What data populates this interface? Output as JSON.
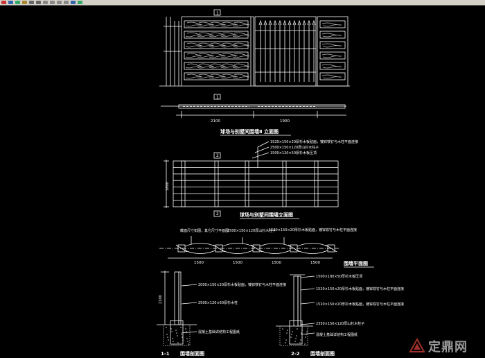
{
  "colors": {
    "background": "#000000",
    "lines": "#ffffff",
    "toolbar": "#d4d0c8",
    "watermark": "#9a9a9a"
  },
  "toolbar": {
    "icons": [
      "cut-icon",
      "copy-icon",
      "paste-icon",
      "match-properties-icon",
      "undo-icon",
      "redo-icon",
      "pan-icon",
      "zoom-realtime-icon",
      "zoom-window-icon",
      "zoom-previous-icon",
      "properties-icon",
      "design-center-icon"
    ]
  },
  "elevation1": {
    "section_marker_top": "1",
    "section_marker_bottom": "1",
    "dim_left": "2100",
    "dim_right": "1900",
    "title": "球场与别墅间围墙Ⅱ 立面图"
  },
  "elevation2": {
    "marker_top": "2",
    "marker_bottom": "2",
    "note1": "1520×150×20厚杉木板贴面，镀锌铁钉与木柱平面连接",
    "note2": "2500×150×120厚山杉木柱子",
    "note3": "1500×120×50厚杉木板压顶",
    "height_dim": "1800",
    "title": "球场与别墅间围墙立面图"
  },
  "plan": {
    "note1": "截面尺寸如图，其它尺寸平面图",
    "note2": "2500×150×120厚山杉木柱子",
    "note3": "1520×150×20厚杉木板贴面，镀锌铁钉与木柱平面连接",
    "dims": [
      "1500",
      "1500",
      "1500",
      "1500"
    ],
    "title": "围墙平面图"
  },
  "section1": {
    "note1": "2000×150×20厚杉木板贴面，镀锌铁钉与木柱平面连接",
    "note2": "2500×120×60厚杉木柱",
    "note3": "混凝土基础详结构工程图纸",
    "height_dim": "2100",
    "label": "1-1",
    "title": "围墙剖面图"
  },
  "section2": {
    "note1": "1500×180×50厚杉木板压顶",
    "note2": "1520×150×20厚杉木板贴面，镀锌铁钉与木柱平面连接",
    "note3": "1520×150×20厚杉木板贴面，镀锌铁钉与木柱平面连接",
    "note4": "2350×150×120厚山杉木柱子",
    "note5": "混凝土基础详结构工程图纸",
    "label": "2-2",
    "title": "围墙剖面图"
  },
  "watermark": {
    "text": "定鼎网"
  }
}
